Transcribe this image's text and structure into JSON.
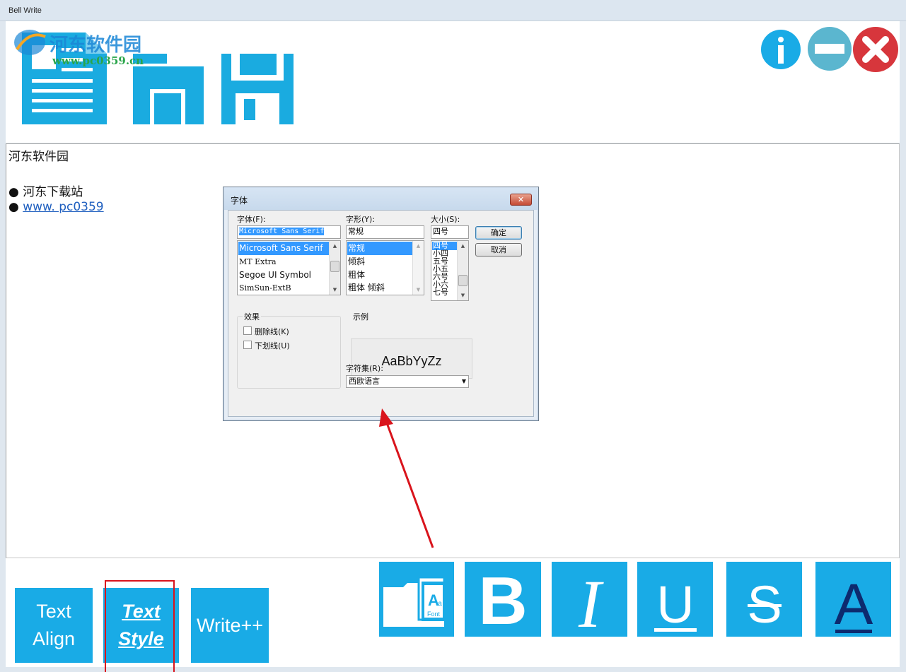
{
  "window": {
    "title": "Bell Write"
  },
  "watermark": {
    "site_name": "河东软件园",
    "site_url": "www.pc0359.cn"
  },
  "toolbar": {
    "new_icon": "document-icon",
    "open_icon": "folder-icon",
    "save_icon": "floppy-disk-icon",
    "info_icon": "info-icon",
    "minimize_icon": "minimize-icon",
    "close_icon": "close-icon"
  },
  "editor": {
    "lines": [
      "河东软件园",
      "● 河东下载站",
      "● "
    ],
    "link_text": "www. pc0359"
  },
  "bottom_tabs": {
    "text_align": [
      "Text",
      "Align"
    ],
    "text_style": [
      "Text",
      "Style"
    ],
    "write_plus": "Write++"
  },
  "format_buttons": [
    {
      "name": "font-icon",
      "label": "Font"
    },
    {
      "name": "bold-icon",
      "label": "B"
    },
    {
      "name": "italic-icon",
      "label": "I"
    },
    {
      "name": "underline-icon",
      "label": "U"
    },
    {
      "name": "strikethrough-icon",
      "label": "S"
    },
    {
      "name": "font-color-icon",
      "label": "A"
    }
  ],
  "font_dialog": {
    "title": "字体",
    "close_glyph": "✕",
    "font_label": "字体(F):",
    "style_label": "字形(Y):",
    "size_label": "大小(S):",
    "font_value": "Microsoft Sans Serif",
    "style_value": "常规",
    "size_value": "四号",
    "font_list": [
      "Microsoft Sans Serif",
      "MT Extra",
      "Segoe UI Symbol",
      "SimSun-ExtB"
    ],
    "style_list": [
      "常规",
      "倾斜",
      "粗体",
      "粗体 倾斜"
    ],
    "size_list": [
      "四号",
      "小四",
      "五号",
      "小五",
      "六号",
      "小六",
      "七号"
    ],
    "ok_label": "确定",
    "cancel_label": "取消",
    "effects_label": "效果",
    "strikeout_label": "删除线(K)",
    "underline_label": "下划线(U)",
    "sample_label": "示例",
    "sample_text": "AaBbYyZz",
    "script_label": "字符集(R):",
    "script_value": "西欧语言"
  },
  "colors": {
    "accent": "#19abe6",
    "close_red": "#d7363c",
    "minimize_teal": "#5bb6cf",
    "annotation_red": "#d9141c"
  }
}
